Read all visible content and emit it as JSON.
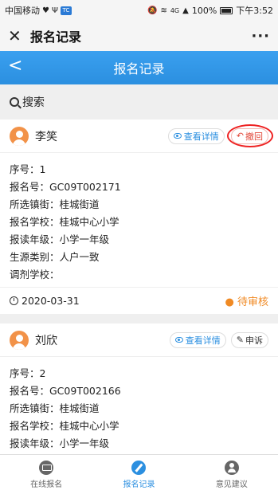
{
  "status_bar": {
    "carrier": "中国移动",
    "signal": "4G",
    "battery": "100%",
    "time": "下午3:52"
  },
  "wx_bar": {
    "close": "✕",
    "title": "报名记录",
    "more": "···"
  },
  "header": {
    "back": "<",
    "title": "报名记录"
  },
  "search": {
    "label": "搜索"
  },
  "records": [
    {
      "name": "李笑",
      "detail_label": "查看详情",
      "action_label": "撤回",
      "rows": [
        "序号：1",
        "报名号：GC09T002171",
        "所选镇街：桂城街道",
        "报名学校：桂城中心小学",
        "报读年级：小学一年级",
        "生源类别：人户一致",
        "调剂学校："
      ],
      "date": "2020-03-31",
      "status": "待审核"
    },
    {
      "name": "刘欣",
      "detail_label": "查看详情",
      "action_label": "申诉",
      "rows": [
        "序号：2",
        "报名号：GC09T002166",
        "所选镇街：桂城街道",
        "报名学校：桂城中心小学",
        "报读年级：小学一年级"
      ]
    }
  ],
  "tabs": [
    {
      "label": "在线报名",
      "icon": "monitor-icon"
    },
    {
      "label": "报名记录",
      "icon": "pencil-icon"
    },
    {
      "label": "意见建议",
      "icon": "user-icon"
    }
  ],
  "colors": {
    "accent": "#2b8fe0",
    "status_pending": "#f08a24",
    "recall": "#e24a3b"
  }
}
